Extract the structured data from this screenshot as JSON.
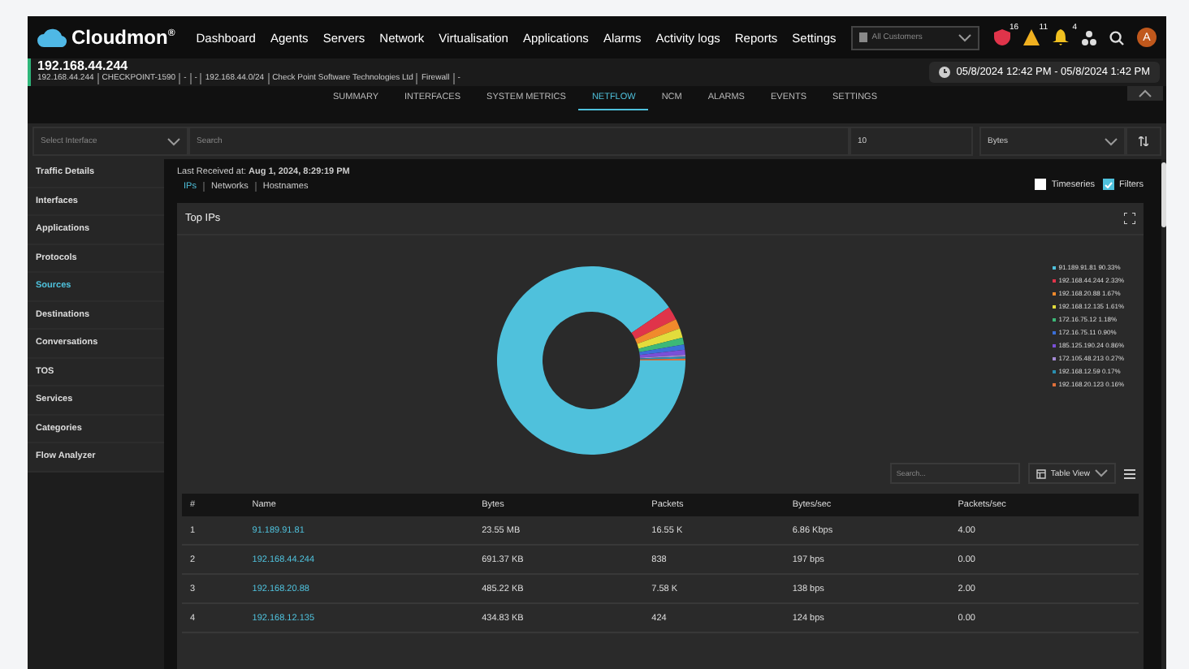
{
  "top_nav": {
    "brand": "Cloudmon",
    "brand_mark": "®",
    "menu": [
      {
        "label": "Dashboard"
      },
      {
        "label": "Agents"
      },
      {
        "label": "Servers"
      },
      {
        "label": "Network"
      },
      {
        "label": "Virtualisation"
      },
      {
        "label": "Applications"
      },
      {
        "label": "Alarms"
      },
      {
        "label": "Activity logs"
      },
      {
        "label": "Reports"
      },
      {
        "label": "Settings"
      }
    ],
    "customer_select": "All Customers",
    "badges": [
      {
        "kind": "shield",
        "count": "16"
      },
      {
        "kind": "warning",
        "count": "11"
      },
      {
        "kind": "bell",
        "count": "4"
      }
    ],
    "avatar": "A"
  },
  "device": {
    "title": "192.168.44.244",
    "details": [
      "192.168.44.244",
      "CHECKPOINT-1590",
      "-",
      "-",
      "192.168.44.0/24",
      "Check Point Software Technologies Ltd",
      "Firewall",
      "-"
    ],
    "time_range": "05/8/2024 12:42 PM - 05/8/2024 1:42 PM"
  },
  "tabs": [
    {
      "label": "SUMMARY",
      "selected": false
    },
    {
      "label": "INTERFACES",
      "selected": false
    },
    {
      "label": "SYSTEM METRICS",
      "selected": false
    },
    {
      "label": "NETFLOW",
      "selected": true
    },
    {
      "label": "NCM",
      "selected": false
    },
    {
      "label": "ALARMS",
      "selected": false
    },
    {
      "label": "EVENTS",
      "selected": false
    },
    {
      "label": "SETTINGS",
      "selected": false
    }
  ],
  "filters": {
    "interface": {
      "placeholder": "Select Interface"
    },
    "search": {
      "placeholder": "Search"
    },
    "count": "10",
    "metric": "Bytes"
  },
  "sidebar": {
    "items": [
      {
        "label": "Traffic Details",
        "selected": false
      },
      {
        "label": "Interfaces",
        "selected": false
      },
      {
        "label": "Applications",
        "selected": false
      },
      {
        "label": "Protocols",
        "selected": false
      },
      {
        "label": "Sources",
        "selected": true
      },
      {
        "label": "Destinations",
        "selected": false
      },
      {
        "label": "Conversations",
        "selected": false
      },
      {
        "label": "TOS",
        "selected": false
      },
      {
        "label": "Services",
        "selected": false
      },
      {
        "label": "Categories",
        "selected": false
      },
      {
        "label": "Flow Analyzer",
        "selected": false
      }
    ]
  },
  "last_received": "Last Received at: **Aug 1, 2024, 8:29:19 PM**",
  "sub_tabs": [
    {
      "label": "IPs",
      "selected": true
    },
    {
      "label": "Networks",
      "selected": false
    },
    {
      "label": "Hostnames",
      "selected": false
    }
  ],
  "options": [
    {
      "label": "Timeseries",
      "checked": false
    },
    {
      "label": "Filters",
      "checked": true
    }
  ],
  "panel": {
    "title": "Top IPs",
    "chart_data": {
      "type": "donut",
      "categories": [
        "91.189.91.81",
        "192.168.44.244",
        "192.168.20.88",
        "192.168.12.135",
        "172.16.75.12",
        "172.16.75.11",
        "185.125.190.24",
        "172.105.48.213",
        "192.168.12.59",
        "192.168.20.123"
      ],
      "values": [
        90.33,
        2.33,
        1.67,
        1.61,
        1.18,
        0.9,
        0.86,
        0.27,
        0.17,
        0.16
      ],
      "legend": true,
      "colors": [
        "#4fc1dc",
        "#e0344a",
        "#f08a2c",
        "#e2dc3c",
        "#3cb878",
        "#3a6fd8",
        "#7a4fd8",
        "#a48ad4",
        "#2a8fb0",
        "#e0703a"
      ],
      "value_labels": [
        "90.33%",
        "2.33%",
        "1.67%",
        "1.61%",
        "1.18%",
        "0.90%",
        "0.86%",
        "0.27%",
        "0.17%",
        "0.16%"
      ]
    },
    "table_search": {
      "placeholder": "Search..."
    },
    "view_select": "Table View",
    "table": {
      "columns": [
        "#",
        "Name",
        "Bytes",
        "Packets",
        "Bytes/sec",
        "Packets/sec"
      ],
      "rows": [
        [
          "1",
          "91.189.91.81",
          "23.55 MB",
          "16.55 K",
          "6.86 Kbps",
          "4.00"
        ],
        [
          "2",
          "192.168.44.244",
          "691.37 KB",
          "838",
          "197 bps",
          "0.00"
        ],
        [
          "3",
          "192.168.20.88",
          "485.22 KB",
          "7.58 K",
          "138 bps",
          "2.00"
        ],
        [
          "4",
          "192.168.12.135",
          "434.83 KB",
          "424",
          "124 bps",
          "0.00"
        ]
      ]
    }
  }
}
